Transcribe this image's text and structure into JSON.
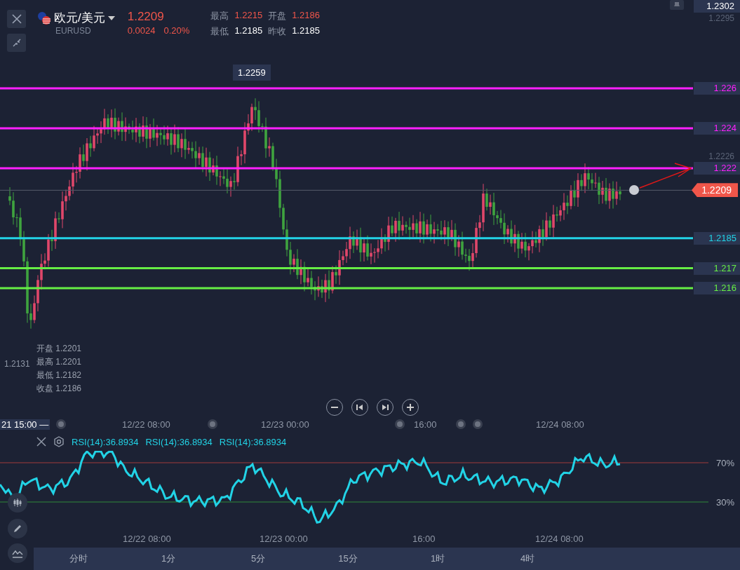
{
  "header": {
    "name": "欧元/美元",
    "symbol": "EURUSD",
    "price": "1.2209",
    "change": "0.0024",
    "change_pct": "0.20%",
    "stats": [
      {
        "label": "最高",
        "value": "1.2215",
        "kind": "up"
      },
      {
        "label": "开盘",
        "value": "1.2186",
        "kind": "up"
      },
      {
        "label": "最低",
        "value": "1.2185",
        "kind": "flat"
      },
      {
        "label": "昨收",
        "value": "1.2185",
        "kind": "flat"
      }
    ]
  },
  "price_axis": [
    {
      "label": "1.2302",
      "kind": "boxed"
    },
    {
      "label": "1.2295",
      "kind": "plain"
    },
    {
      "label": "1.2226",
      "kind": "plain"
    }
  ],
  "levels": [
    {
      "price": "1.226",
      "color": "#ff1fff"
    },
    {
      "price": "1.224",
      "color": "#ff1fff"
    },
    {
      "price": "1.222",
      "color": "#ff1fff"
    },
    {
      "price": "1.2185",
      "color": "#22d3e6"
    },
    {
      "price": "1.217",
      "color": "#66ee44"
    },
    {
      "price": "1.216",
      "color": "#66ee44"
    }
  ],
  "current_price": "1.2209",
  "high_marker": "1.2259",
  "low_marker": "1.2131",
  "ohlc_tooltip": [
    {
      "label": "开盘",
      "value": "1.2201"
    },
    {
      "label": "最高",
      "value": "1.2201"
    },
    {
      "label": "最低",
      "value": "1.2182"
    },
    {
      "label": "收盘",
      "value": "1.2186"
    }
  ],
  "time_axis": [
    {
      "label": "21 15:00 —",
      "kind": "cursor"
    },
    {
      "label": "12/22 08:00",
      "kind": "tick"
    },
    {
      "label": "12/23 00:00",
      "kind": "tick"
    },
    {
      "label": "16:00",
      "kind": "tick"
    },
    {
      "label": "12/24 08:00",
      "kind": "tick"
    }
  ],
  "rsi": {
    "labels": [
      "RSI(14):36.8934",
      "RSI(14):36.8934",
      "RSI(14):36.8934"
    ],
    "levels": [
      "70%",
      "30%"
    ],
    "time_axis": [
      "12/22 08:00",
      "12/23 00:00",
      "16:00",
      "12/24 08:00"
    ]
  },
  "timeframes": [
    "分时",
    "1分",
    "5分",
    "15分",
    "1时",
    "4时"
  ]
}
